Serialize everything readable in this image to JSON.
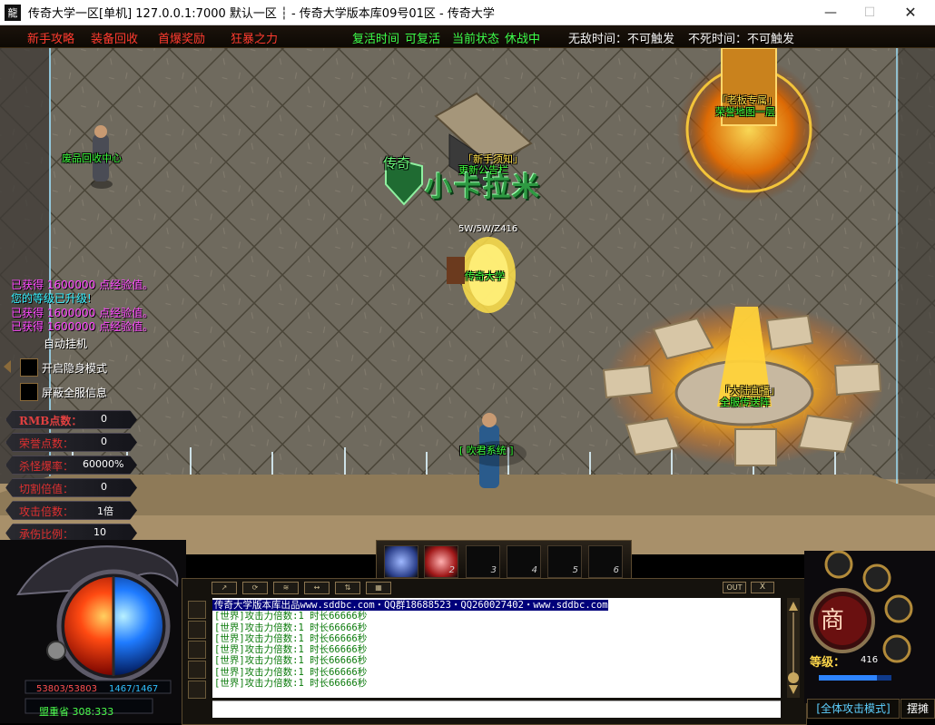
{
  "window": {
    "title": "传奇大学一区[单机] 127.0.0.1:7000  默认一区 ┆ - 传奇大学版本库09号01区 - 传奇大学",
    "app_icon": "龍",
    "minimize": "—",
    "maximize": "☐",
    "close": "✕"
  },
  "top_menu": {
    "items": [
      "新手攻略",
      "装备回收",
      "首爆奖励",
      "狂暴之力"
    ],
    "revive_time": "复活时间",
    "revive_status": "可复活",
    "current_state": "当前状态",
    "combat_state": "休战中",
    "invincible": "无敌时间：不可触发",
    "immortal": "不死时间：不可触发"
  },
  "world": {
    "npc_recycle": "废品回收中心",
    "npc_board": [
      "「新手须知」",
      "更新公告栏"
    ],
    "watermark": "小卡拉米",
    "watermark_prefix": "传奇",
    "npc_boss": [
      "「老板专属」",
      "荣誉地图一层"
    ],
    "player_name": "传奇大学",
    "player_title": "5W/5W/Z416",
    "npc_teleport": [
      "「大陆直播」",
      "全服传送阵"
    ],
    "npc_warrior": "[ 吹君系统 ]"
  },
  "system_messages": [
    {
      "text": "已获得 1600000 点经验值。",
      "color": "#ff49ff"
    },
    {
      "text": "您的等级已升级!",
      "color": "#34f0ff"
    },
    {
      "text": "已获得 1600000 点经验值。",
      "color": "#ff49ff"
    },
    {
      "text": "已获得 1600000 点经验值。",
      "color": "#ff49ff"
    }
  ],
  "auto_hangup": "自动挂机",
  "options": [
    {
      "label": "开启隐身模式"
    },
    {
      "label": "屏蔽全服信息"
    }
  ],
  "stats": [
    {
      "label": "RMB点数：",
      "value": "0"
    },
    {
      "label": "荣誉点数：",
      "value": "0"
    },
    {
      "label": "杀怪爆率：",
      "value": "60000%"
    },
    {
      "label": "切割倍值：",
      "value": "0"
    },
    {
      "label": "攻击倍数：",
      "value": "1倍"
    },
    {
      "label": "承伤比例：",
      "value": "10"
    }
  ],
  "skill_slots": [
    "",
    "2",
    "3",
    "4",
    "5",
    "6"
  ],
  "chat": {
    "toolbar": [
      "↗",
      "⟳",
      "≋",
      "↔",
      "⇅",
      "▦"
    ],
    "out_label": "OUT",
    "close_label": "X",
    "lines": [
      "传奇大学版本库出品www.sddbc.com・QQ群18688523・QQ260027402・www.sddbc.com",
      "[世界]攻击力倍数:1 时长66666秒",
      "[世界]攻击力倍数:1 时长66666秒",
      "[世界]攻击力倍数:1 时长66666秒",
      "[世界]攻击力倍数:1 时长66666秒",
      "[世界]攻击力倍数:1 时长66666秒",
      "[世界]攻击力倍数:1 时长66666秒",
      "[世界]攻击力倍数:1 时长66666秒"
    ]
  },
  "hud": {
    "hp": "53803/53803",
    "mp": "1467/1467",
    "location": "盟重省 308:333",
    "level_label": "等级：",
    "level": "416",
    "shop": "商",
    "attack_mode": "[全体攻击模式]",
    "stall": "摆摊"
  }
}
